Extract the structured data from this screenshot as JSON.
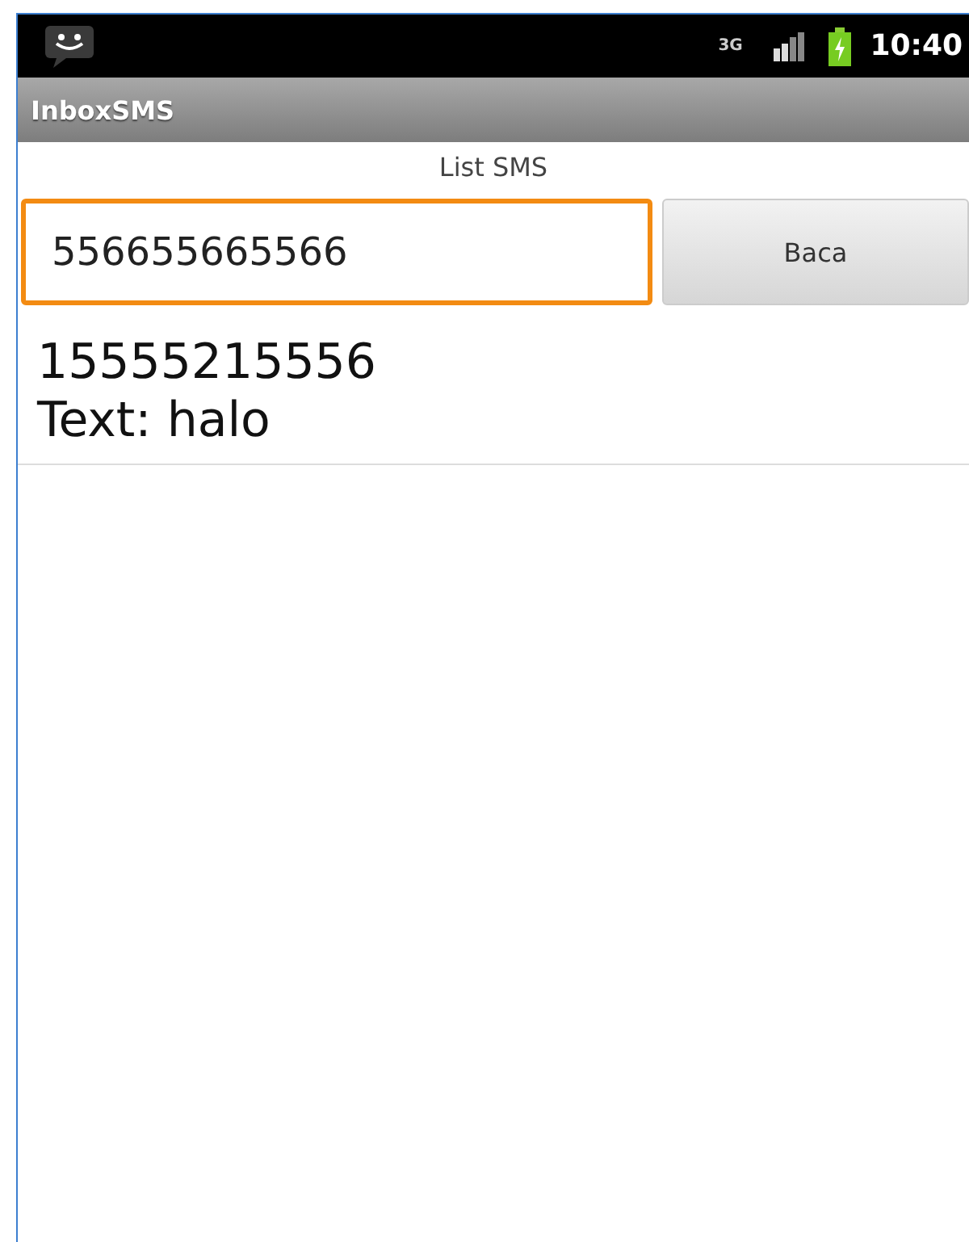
{
  "status_bar": {
    "network": "3G",
    "time": "10:40"
  },
  "window": {
    "title": "InboxSMS"
  },
  "header": "List SMS",
  "number_field": {
    "value": "556655665566",
    "focused": true
  },
  "read_button": {
    "label": "Baca"
  },
  "messages": [
    {
      "sender": "15555215556",
      "body": "Text: halo"
    }
  ]
}
